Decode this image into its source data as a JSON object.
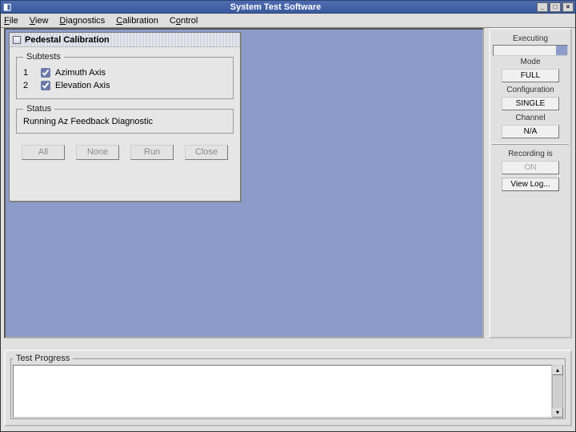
{
  "window": {
    "title": "System Test Software",
    "menu": [
      "File",
      "View",
      "Diagnostics",
      "Calibration",
      "Control"
    ]
  },
  "dialog": {
    "title": "Pedestal Calibration",
    "subtests_legend": "Subtests",
    "subtests": [
      {
        "num": "1",
        "label": "Azimuth Axis"
      },
      {
        "num": "2",
        "label": "Elevation Axis"
      }
    ],
    "status_legend": "Status",
    "status_text": "Running Az Feedback Diagnostic",
    "buttons": {
      "all": "All",
      "none": "None",
      "run": "Run",
      "close": "Close"
    }
  },
  "side": {
    "executing_label": "Executing",
    "mode_label": "Mode",
    "mode_value": "FULL",
    "config_label": "Configuration",
    "config_value": "SINGLE",
    "channel_label": "Channel",
    "channel_value": "N/A",
    "recording_label": "Recording is",
    "recording_value": "ON",
    "viewlog_label": "View Log..."
  },
  "bottom": {
    "legend": "Test Progress"
  }
}
